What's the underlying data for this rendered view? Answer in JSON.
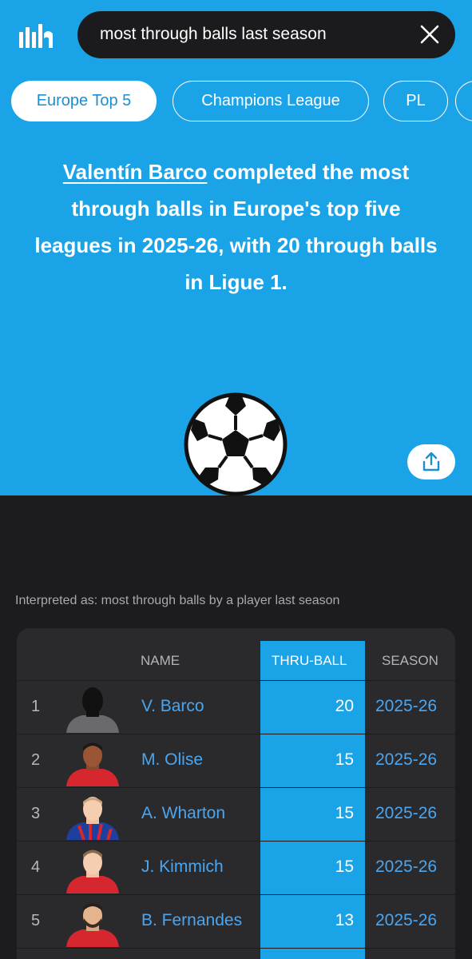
{
  "search": {
    "query": "most through balls last season"
  },
  "chips": [
    {
      "label": "Europe Top 5",
      "active": true
    },
    {
      "label": "Champions League",
      "active": false
    },
    {
      "label": "PL",
      "active": false
    }
  ],
  "headline": {
    "player_name": "Valentín Barco",
    "text": " completed the most through balls in Europe's top five leagues in 2025-26, with 20 through balls in Ligue 1."
  },
  "interpreted_as": "Interpreted as: most through balls by a player last season",
  "table": {
    "columns": {
      "name": "NAME",
      "thru_ball": "THRU-BALL",
      "season": "SEASON"
    },
    "rows": [
      {
        "rank": "1",
        "name": "V. Barco",
        "thru_ball": "20",
        "season": "2025-26"
      },
      {
        "rank": "2",
        "name": "M. Olise",
        "thru_ball": "15",
        "season": "2025-26"
      },
      {
        "rank": "3",
        "name": "A. Wharton",
        "thru_ball": "15",
        "season": "2025-26"
      },
      {
        "rank": "4",
        "name": "J. Kimmich",
        "thru_ball": "15",
        "season": "2025-26"
      },
      {
        "rank": "5",
        "name": "B. Fernandes",
        "thru_ball": "13",
        "season": "2025-26"
      }
    ]
  },
  "colors": {
    "accent": "#1ba3e8",
    "link": "#4aa6f0",
    "background": "#1c1c1e",
    "card": "#2a2a2d"
  },
  "icons": {
    "logo": "statmuse-logo",
    "clear": "close-icon",
    "share": "share-icon",
    "hero": "soccer-ball-icon"
  }
}
